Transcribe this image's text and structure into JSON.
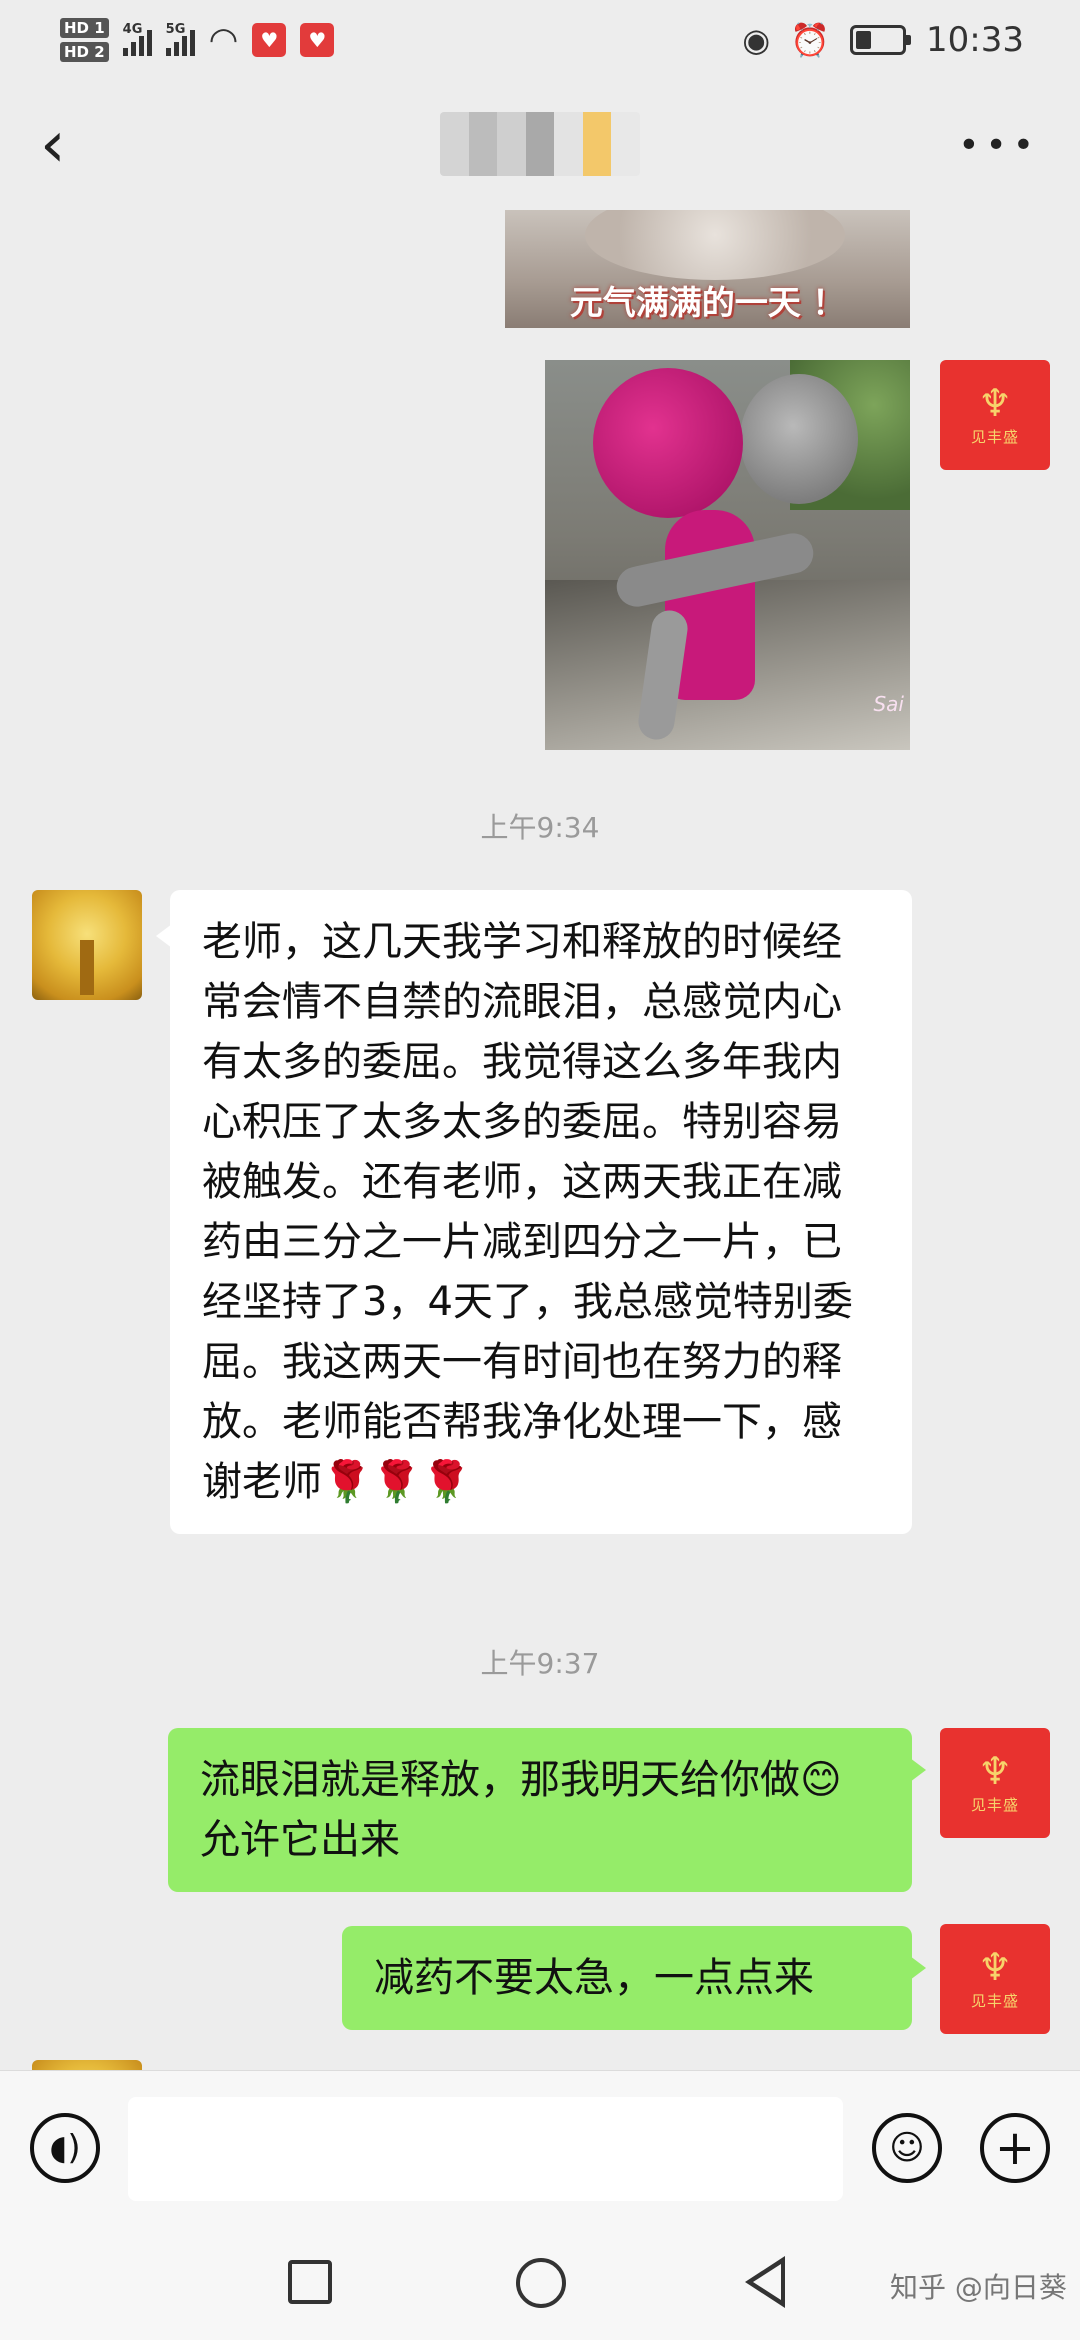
{
  "status_bar": {
    "hd1": "HD 1",
    "hd2": "HD 2",
    "signal1_label": "4G",
    "signal2_label": "5G",
    "time": "10:33"
  },
  "chat": {
    "image_caption": "元气满满的一天 ！",
    "knit_signature": "Sai",
    "brand_avatar_text": "见丰盛",
    "timestamp_1": "上午9:34",
    "message_1": "老师，这几天我学习和释放的时候经常会情不自禁的流眼泪，总感觉内心有太多的委屈。我觉得这么多年我内心积压了太多太多的委屈。特别容易被触发。还有老师，这两天我正在减药由三分之一片减到四分之一片，已经坚持了3，4天了，我总感觉特别委屈。我这两天一有时间也在努力的释放。老师能否帮我净化处理一下，感谢老师🌹🌹🌹",
    "timestamp_2": "上午9:37",
    "reply_1": "流眼泪就是释放，那我明天给你做😊允许它出来",
    "reply_2": "减药不要太急，一点点来"
  },
  "footer": {
    "watermark": "知乎 @向日葵"
  },
  "icons": {
    "back": "chevron-left-icon",
    "more": "more-dots-icon",
    "voice": "voice-icon",
    "emoji": "emoji-icon",
    "plus": "plus-icon"
  },
  "colors": {
    "background": "#ededed",
    "bubble_sent": "#95ec69",
    "bubble_received": "#ffffff",
    "brand_avatar": "#e8322f"
  }
}
